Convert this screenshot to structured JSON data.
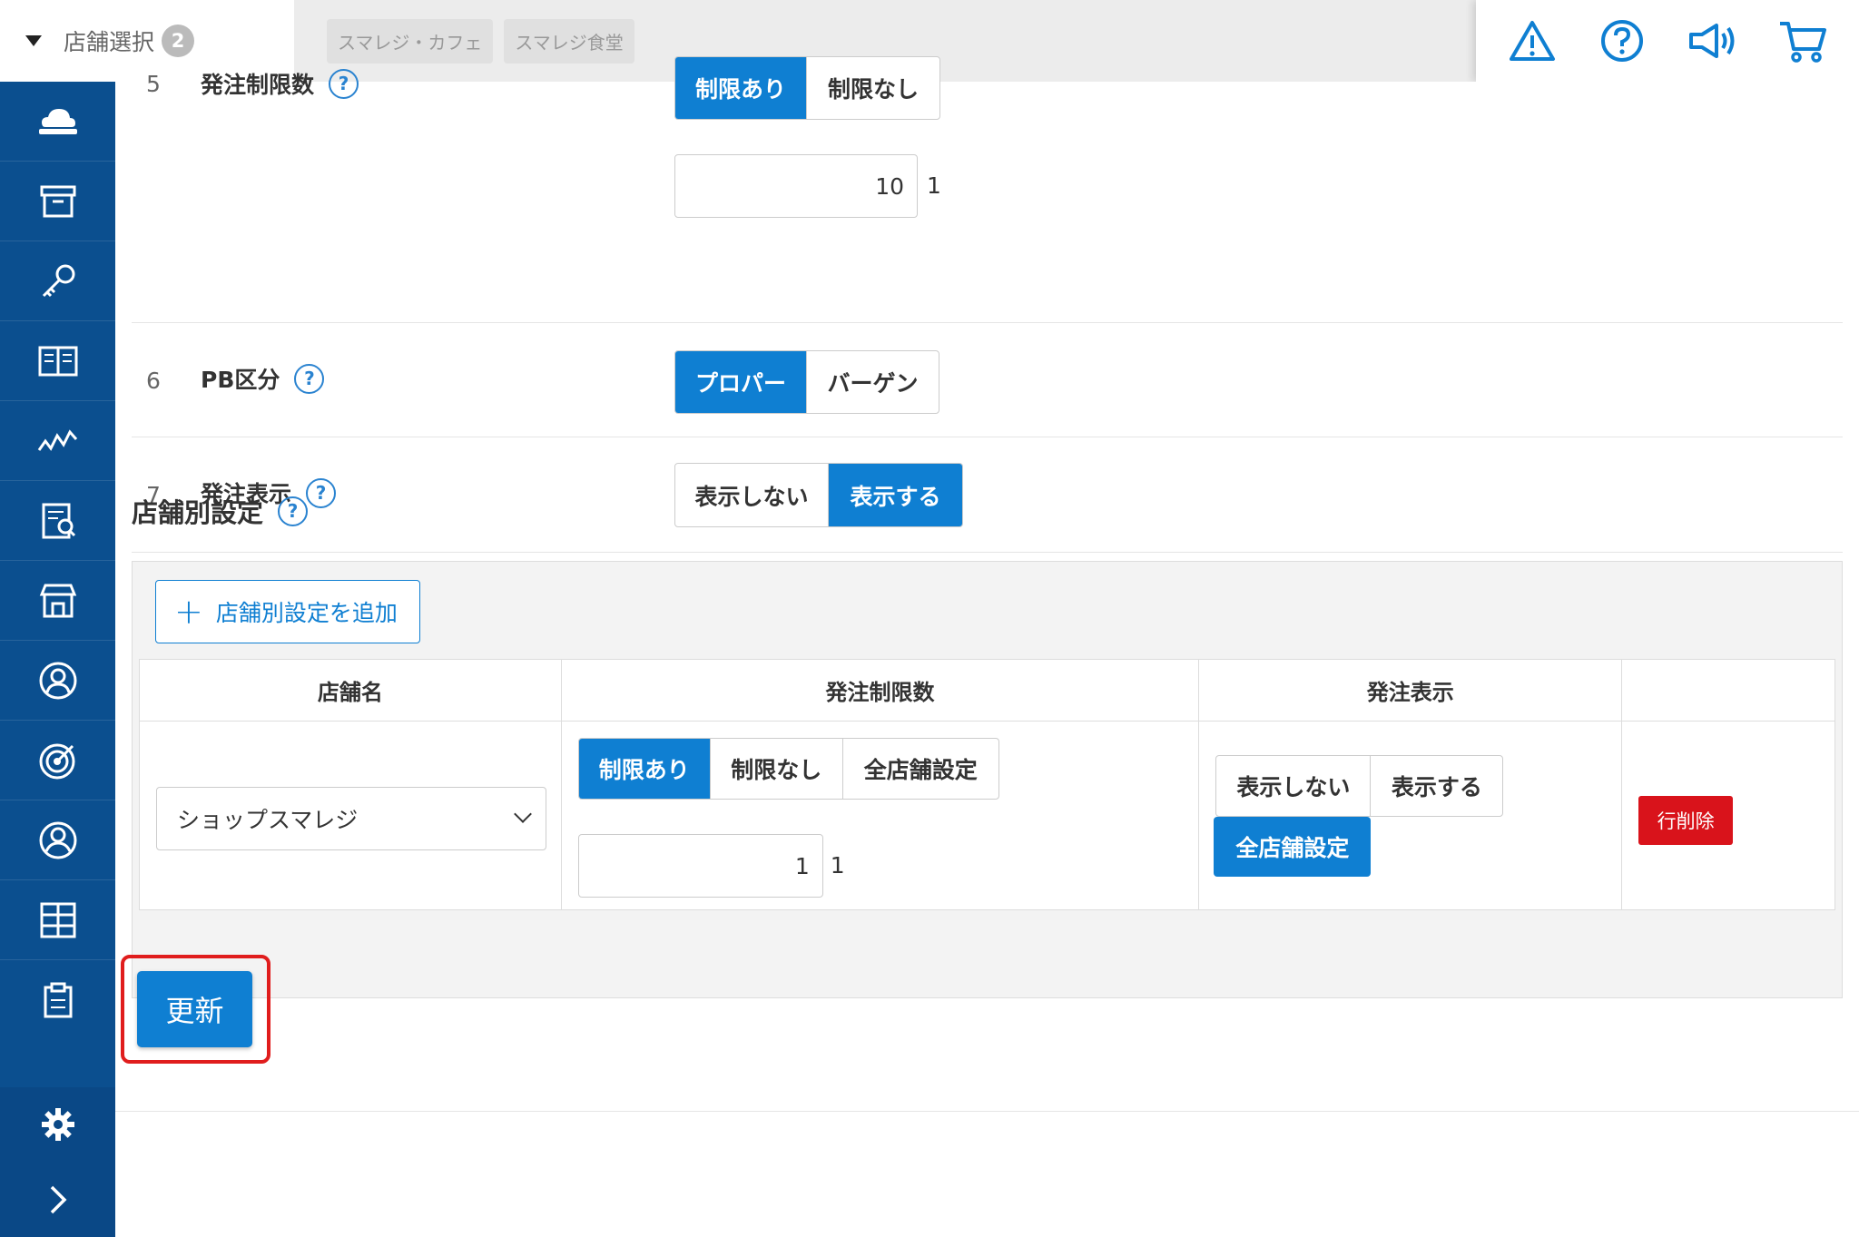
{
  "header": {
    "store_select_label": "店舗選択",
    "store_count": "2",
    "stores": [
      "スマレジ・カフェ",
      "スマレジ食堂"
    ],
    "icons": [
      "warning-icon",
      "help-icon",
      "megaphone-icon",
      "cart-icon"
    ]
  },
  "sidebar": {
    "items": [
      "cloud-icon",
      "archive-box-icon",
      "key-icon",
      "book-icon",
      "chart-line-icon",
      "report-icon",
      "store-icon",
      "user-circle-icon",
      "target-icon",
      "customer-icon",
      "grid-icon",
      "clipboard-icon"
    ],
    "settings": "gear-icon",
    "expand": "chevron-right-icon"
  },
  "rows": {
    "r5": {
      "num": "5",
      "label": "発注制限数",
      "opt1": "制限あり",
      "opt2": "制限なし",
      "value": "10",
      "unit": "1"
    },
    "r6": {
      "num": "6",
      "label": "PB区分",
      "opt1": "プロパー",
      "opt2": "バーゲン"
    },
    "r7": {
      "num": "7",
      "label": "発注表示",
      "opt1": "表示しない",
      "opt2": "表示する"
    }
  },
  "store_settings": {
    "title": "店舗別設定",
    "add_button": "店舗別設定を追加",
    "columns": [
      "店舗名",
      "発注制限数",
      "発注表示",
      ""
    ],
    "row": {
      "store": "ショップスマレジ",
      "limit_opts": [
        "制限あり",
        "制限なし",
        "全店舗設定"
      ],
      "limit_value": "1",
      "limit_unit": "1",
      "display_opts": [
        "表示しない",
        "表示する"
      ],
      "display_all": "全店舗設定",
      "delete": "行削除"
    }
  },
  "help_mark": "?",
  "update_button": "更新",
  "colors": {
    "primary": "#0f7fd2",
    "sidebar": "#0b4f8f",
    "danger": "#d9131b",
    "highlight": "#e01d1d"
  }
}
